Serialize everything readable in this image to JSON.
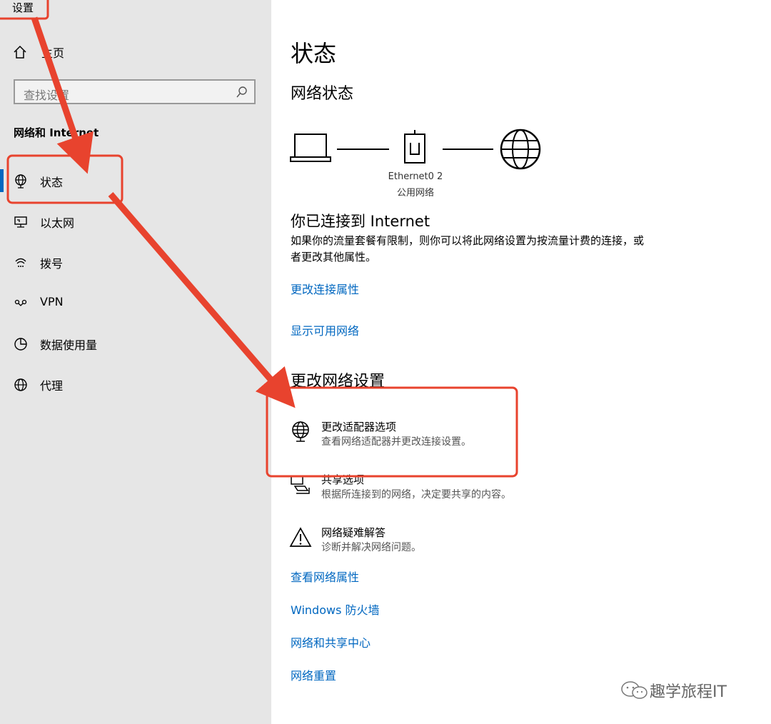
{
  "app_title": "设置",
  "sidebar": {
    "home_label": "主页",
    "search_placeholder": "查找设置",
    "section": "网络和 Internet",
    "items": [
      {
        "label": "状态",
        "icon": "globe-stand-icon",
        "active": true
      },
      {
        "label": "以太网",
        "icon": "ethernet-monitor-icon"
      },
      {
        "label": "拨号",
        "icon": "dialup-icon"
      },
      {
        "label": "VPN",
        "icon": "vpn-icon"
      },
      {
        "label": "数据使用量",
        "icon": "pie-chart-icon"
      },
      {
        "label": "代理",
        "icon": "globe-icon"
      }
    ]
  },
  "main": {
    "page_title": "状态",
    "network_status_heading": "网络状态",
    "adapter_name": "Ethernet0 2",
    "network_type": "公用网络",
    "connected_title": "你已连接到 Internet",
    "connected_desc": "如果你的流量套餐有限制，则你可以将此网络设置为按流量计费的连接，或者更改其他属性。",
    "links_top": [
      "更改连接属性",
      "显示可用网络"
    ],
    "change_heading": "更改网络设置",
    "options": [
      {
        "title": "更改适配器选项",
        "desc": "查看网络适配器并更改连接设置。",
        "icon": "adapter-globe-icon"
      },
      {
        "title": "共享选项",
        "desc": "根据所连接到的网络，决定要共享的内容。",
        "icon": "sharing-icon"
      },
      {
        "title": "网络疑难解答",
        "desc": "诊断并解决网络问题。",
        "icon": "warning-icon"
      }
    ],
    "links_bottom": [
      "查看网络属性",
      "Windows 防火墙",
      "网络和共享中心",
      "网络重置"
    ]
  },
  "watermark": "趣学旅程IT",
  "colors": {
    "accent": "#0067c0",
    "annotation": "#e8432e",
    "sidebar_bg": "#e6e6e6"
  }
}
